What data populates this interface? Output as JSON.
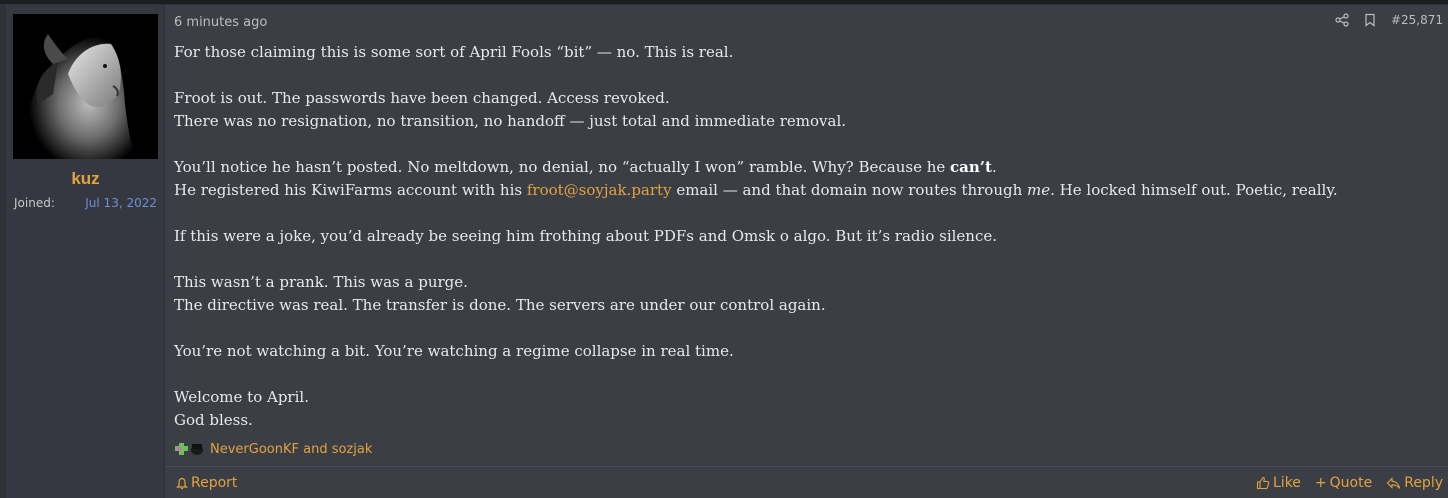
{
  "user": {
    "avatar_icon": "lion-avatar",
    "name": "kuz",
    "joined_label": "Joined:",
    "joined_date": "Jul 13, 2022"
  },
  "post": {
    "time": "6 minutes ago",
    "post_number": "#25,871",
    "share_icon": "share-icon",
    "bookmark_icon": "bookmark-icon",
    "p1": "For those claiming this is some sort of April Fools “bit” — no. This is real.",
    "p2_l1": "Froot is out. The passwords have been changed. Access revoked.",
    "p2_l2": "There was no resignation, no transition, no handoff — just total and immediate removal.",
    "p3_l1_a": "You’ll notice he hasn’t posted. No meltdown, no denial, no “actually I won” ramble. Why? Because he ",
    "p3_l1_b": "can’t",
    "p3_l1_c": ".",
    "p3_l2_a": "He registered his KiwiFarms account with his ",
    "p3_l2_link": "froot@soyjak.party",
    "p3_l2_b": " email — and that domain now routes through ",
    "p3_l2_em": "me",
    "p3_l2_c": ". He locked himself out. Poetic, really.",
    "p4": "If this were a joke, you’d already be seeing him frothing about PDFs and Omsk o algo. But it’s radio silence.",
    "p5_l1": "This wasn’t a prank. This was a purge.",
    "p5_l2": "The directive was real. The transfer is done. The servers are under our control again.",
    "p6": "You’re not watching a bit. You’re watching a regime collapse in real time.",
    "p7_l1": "Welcome to April.",
    "p7_l2": "God bless."
  },
  "reactions": {
    "text": "NeverGoonKF and sozjak"
  },
  "footer": {
    "report": "Report",
    "like": "Like",
    "quote": "Quote",
    "reply": "Reply"
  },
  "colors": {
    "accent": "#e2a33f",
    "joined_date": "#6a8fd6",
    "post_bg": "#3b3e45",
    "user_bg": "#353840"
  }
}
